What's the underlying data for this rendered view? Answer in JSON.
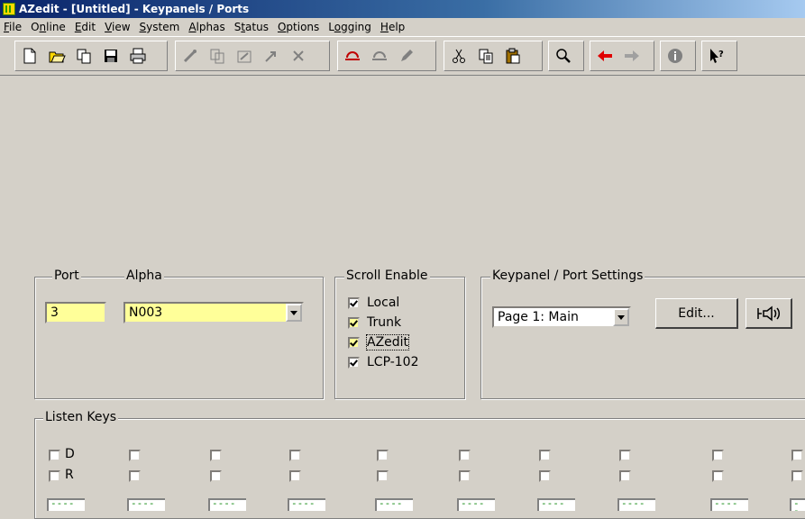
{
  "window": {
    "title": "AZedit - [Untitled] - Keypanels / Ports"
  },
  "menu": [
    {
      "label": "File",
      "u": "F",
      "rest": "ile"
    },
    {
      "label": "Online",
      "u": "",
      "rest": "Online"
    },
    {
      "label": "Edit",
      "u": "E",
      "rest": "dit"
    },
    {
      "label": "View",
      "u": "V",
      "rest": "iew"
    },
    {
      "label": "System",
      "u": "S",
      "rest": "ystem"
    },
    {
      "label": "Alphas",
      "u": "A",
      "rest": "lphas"
    },
    {
      "label": "Status",
      "u": "",
      "rest": "Status"
    },
    {
      "label": "Options",
      "u": "O",
      "rest": "ptions"
    },
    {
      "label": "Logging",
      "u": "",
      "rest": "Logging"
    },
    {
      "label": "Help",
      "u": "H",
      "rest": "elp"
    }
  ],
  "port": {
    "legend": "Port",
    "value": "3"
  },
  "alpha": {
    "legend": "Alpha",
    "value": "N003"
  },
  "scroll_enable": {
    "legend": "Scroll Enable",
    "items": [
      {
        "label": "Local",
        "checked": true
      },
      {
        "label": "Trunk",
        "checked": true
      },
      {
        "label": "AZedit",
        "checked": true
      },
      {
        "label": "LCP-102",
        "checked": true
      }
    ]
  },
  "keypanel_settings": {
    "legend": "Keypanel / Port Settings",
    "page_value": "Page 1: Main",
    "edit_label": "Edit..."
  },
  "listen_keys": {
    "legend": "Listen Keys",
    "row_labels": [
      "D",
      "R"
    ],
    "box_text": "----"
  },
  "colors": {
    "field_yellow": "#ffff99",
    "title_blue": "#0a246a",
    "box_text_green": "#008000"
  },
  "icons": [
    "new-icon",
    "open-icon",
    "copy-file-icon",
    "save-icon",
    "print-icon",
    "connect-icon",
    "copy-panel-icon",
    "send-icon",
    "upload-icon",
    "disconnect-icon",
    "undo-icon",
    "redo-icon",
    "pencil-icon",
    "cut-icon",
    "copy-icon",
    "paste-icon",
    "search-icon",
    "back-arrow-icon",
    "forward-arrow-icon",
    "info-icon",
    "help-pointer-icon",
    "speaker-icon"
  ]
}
